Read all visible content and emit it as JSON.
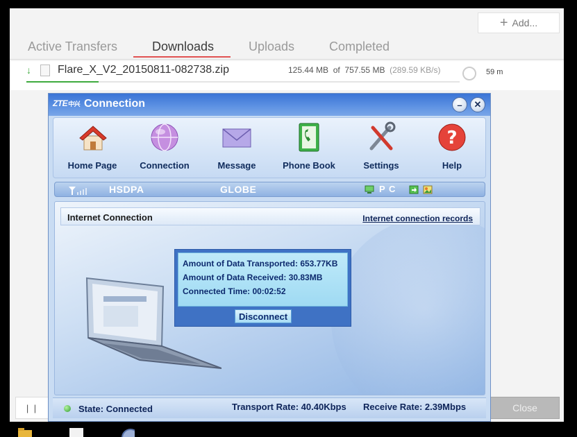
{
  "download_manager": {
    "add_label": "Add...",
    "tabs": [
      {
        "label": "Active Transfers",
        "active": false
      },
      {
        "label": "Downloads",
        "active": true
      },
      {
        "label": "Uploads",
        "active": false
      },
      {
        "label": "Completed",
        "active": false
      }
    ],
    "download": {
      "filename": "Flare_X_V2_20150811-082738.zip",
      "downloaded": "125.44 MB",
      "of_label": "of",
      "total": "757.55 MB",
      "speed": "(289.59 KB/s)",
      "eta": "59 m",
      "progress_fraction": 0.166
    },
    "pause_label": "| |",
    "close_label": "Close",
    "accent_color": "#3daa3d",
    "tab_underline_color": "#e05151"
  },
  "zte": {
    "logo": "ZTE",
    "logo_cn": "中兴",
    "title": "Connection",
    "toolbar": [
      {
        "label": "Home Page",
        "icon": "house-icon"
      },
      {
        "label": "Connection",
        "icon": "globe-icon"
      },
      {
        "label": "Message",
        "icon": "envelope-icon"
      },
      {
        "label": "Phone Book",
        "icon": "phone-book-icon"
      },
      {
        "label": "Settings",
        "icon": "tools-icon"
      },
      {
        "label": "Help",
        "icon": "help-icon"
      }
    ],
    "status_strip": {
      "network_type": "HSDPA",
      "operator": "GLOBE",
      "pc_label": "P C"
    },
    "panel": {
      "title": "Internet Connection",
      "records_link": "Internet connection records",
      "stats": [
        "Amount of Data Transported: 653.77KB",
        "Amount of Data Received: 30.83MB",
        "Connected Time: 00:02:52"
      ],
      "disconnect_label": "Disconnect"
    },
    "bottom": {
      "state": "State: Connected",
      "transport_rate": "Transport Rate: 40.40Kbps",
      "receive_rate": "Receive Rate: 2.39Mbps"
    }
  }
}
